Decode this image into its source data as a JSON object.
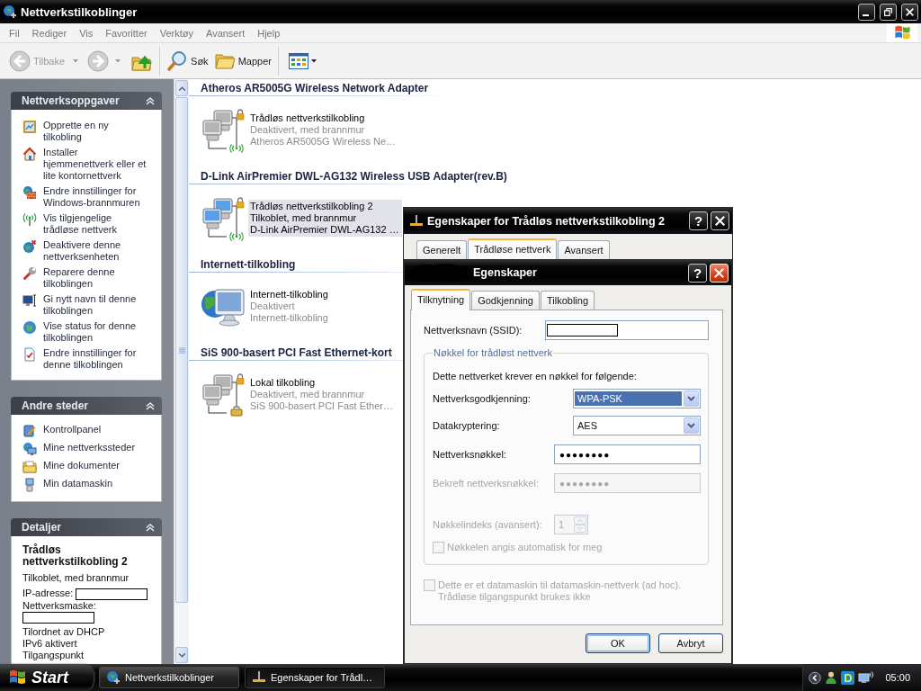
{
  "window": {
    "title": "Nettverkstilkoblinger"
  },
  "menu_bar": [
    "Fil",
    "Rediger",
    "Vis",
    "Favoritter",
    "Verktøy",
    "Avansert",
    "Hjelp"
  ],
  "toolbar": {
    "back": {
      "label": "Tilbake",
      "disabled": true
    },
    "forward": {
      "disabled": true
    },
    "search": {
      "label": "Søk"
    },
    "folders": {
      "label": "Mapper"
    }
  },
  "task_panes": [
    {
      "title": "Nettverksoppgaver",
      "expanded": true,
      "items": [
        "Opprette en ny tilkobling",
        "Installer hjemmenettverk eller et lite kontornettverk",
        "Endre innstillinger for Windows-brannmuren",
        "Vis tilgjengelige trådløse nettverk",
        "Deaktivere denne nettverksenheten",
        "Reparere denne tilkoblingen",
        "Gi nytt navn til denne tilkoblingen",
        "Vise status for denne tilkoblingen",
        "Endre innstillinger for denne tilkoblingen"
      ]
    },
    {
      "title": "Andre steder",
      "expanded": true,
      "items": [
        "Kontrollpanel",
        "Mine nettverkssteder",
        "Mine dokumenter",
        "Min datamaskin"
      ]
    }
  ],
  "details": {
    "title": "Detaljer",
    "expanded": true,
    "name": "Trådløs nettverkstilkobling 2",
    "status": "Tilkoblet, med brannmur",
    "fields": [
      {
        "label": "IP-adresse:",
        "redacted": true
      },
      {
        "label": "Nettverksmaske:",
        "redacted": true
      }
    ],
    "lines": [
      "Tilordnet av DHCP",
      "IPv6 aktivert",
      "Tilgangspunkt"
    ]
  },
  "groups": [
    {
      "title": "Atheros AR5005G Wireless Network Adapter",
      "items": [
        {
          "kind": "wireless",
          "name": "Trådløs nettverkstilkobling",
          "status": "Deaktivert, med brannmur",
          "device": "Atheros AR5005G Wireless Ne…",
          "connected": false,
          "firewall": true,
          "selected": false
        }
      ]
    },
    {
      "title": "D-Link AirPremier DWL-AG132 Wireless USB Adapter(rev.B)",
      "items": [
        {
          "kind": "wireless",
          "name": "Trådløs nettverkstilkobling 2",
          "status": "Tilkoblet, med brannmur",
          "device": "D-Link AirPremier DWL-AG132 …",
          "connected": true,
          "firewall": true,
          "selected": true
        }
      ]
    },
    {
      "title": "Internett-tilkobling",
      "items": [
        {
          "kind": "internet",
          "name": "Internett-tilkobling",
          "status": "Deaktivert",
          "device": "Internett-tilkobling",
          "connected": false,
          "firewall": false,
          "selected": false
        }
      ]
    },
    {
      "title": "SiS 900-basert PCI Fast Ethernet-kort",
      "items": [
        {
          "kind": "lan",
          "name": "Lokal tilkobling",
          "status": "Deaktivert, med brannmur",
          "device": "SiS 900-basert PCI Fast Ether…",
          "connected": false,
          "firewall": true,
          "selected": false
        }
      ]
    }
  ],
  "dialogs": [
    {
      "title": "Egenskaper for Trådløs nettverkstilkobling 2",
      "title_redacted": false,
      "help": "?",
      "active": false,
      "tabs": [
        {
          "label": "Generelt",
          "selected": false
        },
        {
          "label": "Trådløse nettverk",
          "selected": true
        },
        {
          "label": "Avansert",
          "selected": false
        }
      ]
    },
    {
      "title": "Egenskaper",
      "title_redacted": true,
      "help": "?",
      "active": true,
      "tabs": [
        {
          "label": "Tilknytning",
          "selected": true
        },
        {
          "label": "Godkjenning",
          "selected": false
        },
        {
          "label": "Tilkobling",
          "selected": false
        }
      ],
      "ssid": {
        "label": "Nettverksnavn (SSID):",
        "redacted": true
      },
      "key_group": {
        "title": "Nøkkel for trådløst nettverk",
        "intro": "Dette nettverket krever en nøkkel for følgende:",
        "fields": [
          {
            "kind": "select",
            "label": "Nettverksgodkjenning:",
            "value": "WPA-PSK",
            "highlighted": true
          },
          {
            "kind": "select",
            "label": "Datakryptering:",
            "value": "AES",
            "highlighted": false
          },
          {
            "kind": "password",
            "label": "Nettverksnøkkel:",
            "value": "●●●●●●●●",
            "disabled": false
          },
          {
            "kind": "password",
            "label": "Bekreft nettverksnøkkel:",
            "value": "●●●●●●●●",
            "disabled": true
          },
          {
            "kind": "spin",
            "label": "Nøkkelindeks (avansert):",
            "value": "1",
            "disabled": true
          },
          {
            "kind": "checkbox",
            "label": "Nøkkelen angis automatisk for meg",
            "checked": false,
            "disabled": true
          }
        ]
      },
      "adhoc": {
        "label": "Dette er et datamaskin til datamaskin-nettverk (ad hoc).\nTrådløse tilgangspunkt brukes ikke",
        "checked": false,
        "disabled": true
      },
      "buttons": [
        {
          "label": "OK",
          "default": true
        },
        {
          "label": "Avbryt",
          "default": false
        }
      ]
    }
  ],
  "taskbar": {
    "start": "Start",
    "tasks": [
      {
        "label": "Nettverkstilkoblinger",
        "selected": false
      },
      {
        "label": "Egenskaper for Trådl…",
        "selected": true
      }
    ],
    "tray_badge": "D",
    "clock": "05:00"
  }
}
